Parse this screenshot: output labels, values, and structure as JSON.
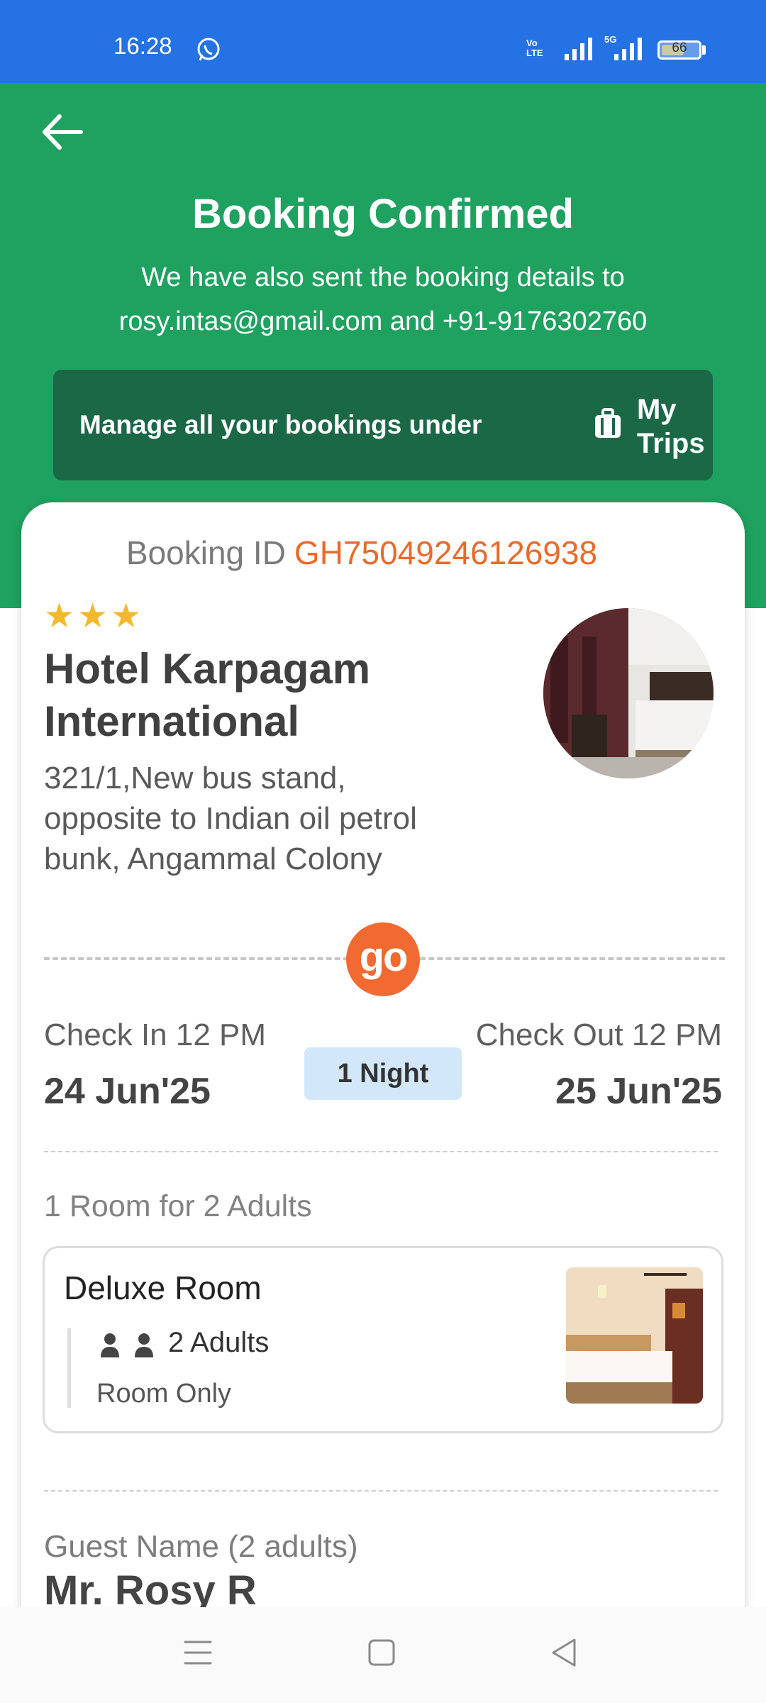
{
  "status_bar": {
    "time": "16:28",
    "volte_line1": "Vo",
    "volte_line2": "LTE",
    "network": "5G",
    "battery": "66",
    "battery_level": 0.66,
    "icons": [
      "whatsapp-icon",
      "signal-icon",
      "signal-5g-icon",
      "battery-icon"
    ]
  },
  "header": {
    "title": "Booking Confirmed",
    "subtitle_line1": "We have also sent the booking details to",
    "subtitle_line2": "rosy.intas@gmail.com and +91-9176302760",
    "manage_text": "Manage all your bookings under",
    "trips_line1": "My",
    "trips_line2": "Trips",
    "background_color": "#1fa260",
    "manage_bar_color": "#1b6847"
  },
  "booking": {
    "id_label": "Booking ID",
    "id_value": "GH75049246126938",
    "id_color": "#e96a2a"
  },
  "hotel": {
    "stars": "★★★",
    "star_rating": 3,
    "name_line1": "Hotel Karpagam",
    "name_line2": "International",
    "address_line1": "321/1,New bus stand,",
    "address_line2": "opposite to Indian oil petrol",
    "address_line3": "bunk, Angammal Colony"
  },
  "brand": {
    "logo_text": "go",
    "color": "#f06a31"
  },
  "stay": {
    "checkin_label": "Check In 12 PM",
    "checkin_date": "24 Jun'25",
    "nights": "1 Night",
    "checkout_label": "Check Out 12 PM",
    "checkout_date": "25 Jun'25"
  },
  "rooms": {
    "summary": "1 Room for 2 Adults",
    "room_name": "Deluxe Room",
    "adults": "2 Adults",
    "plan": "Room Only"
  },
  "guest": {
    "label": "Guest Name (2 adults)",
    "name": "Mr. Rosy R"
  },
  "nav": {
    "icons": [
      "menu-icon",
      "home-icon",
      "back-icon"
    ]
  }
}
